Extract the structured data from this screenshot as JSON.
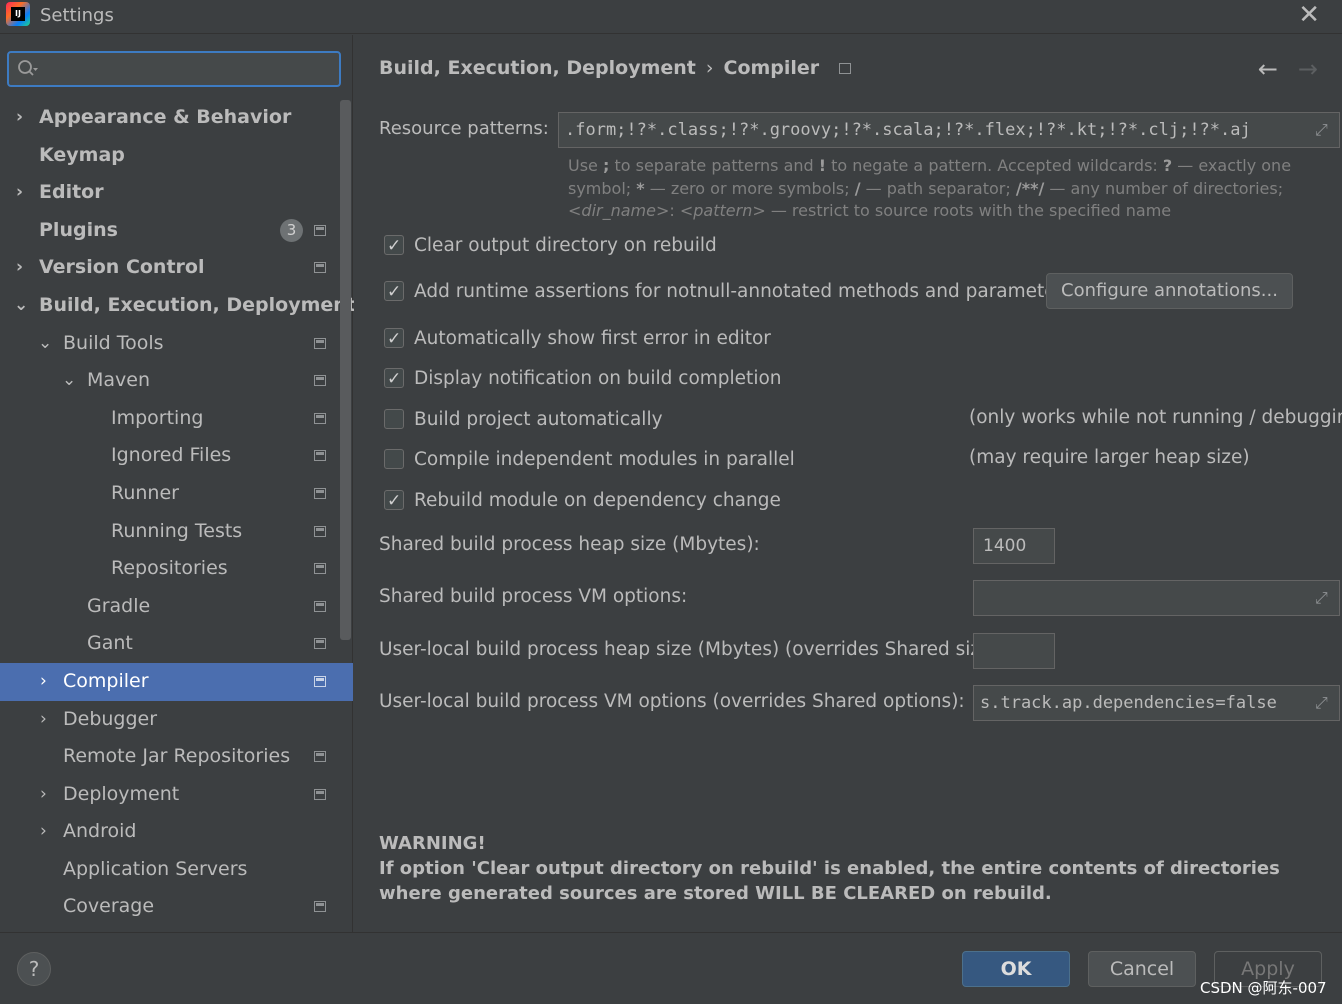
{
  "window": {
    "title": "Settings"
  },
  "search": {
    "placeholder": ""
  },
  "sidebar": {
    "items": [
      {
        "label": "Appearance & Behavior"
      },
      {
        "label": "Keymap"
      },
      {
        "label": "Editor"
      },
      {
        "label": "Plugins",
        "badge": "3"
      },
      {
        "label": "Version Control"
      },
      {
        "label": "Build, Execution, Deployment"
      },
      {
        "label": "Build Tools"
      },
      {
        "label": "Maven"
      },
      {
        "label": "Importing"
      },
      {
        "label": "Ignored Files"
      },
      {
        "label": "Runner"
      },
      {
        "label": "Running Tests"
      },
      {
        "label": "Repositories"
      },
      {
        "label": "Gradle"
      },
      {
        "label": "Gant"
      },
      {
        "label": "Compiler"
      },
      {
        "label": "Debugger"
      },
      {
        "label": "Remote Jar Repositories"
      },
      {
        "label": "Deployment"
      },
      {
        "label": "Android"
      },
      {
        "label": "Application Servers"
      },
      {
        "label": "Coverage"
      }
    ]
  },
  "breadcrumb": {
    "parent": "Build, Execution, Deployment",
    "separator": "›",
    "current": "Compiler"
  },
  "resource_patterns": {
    "label": "Resource patterns:",
    "value": ".form;!?*.class;!?*.groovy;!?*.scala;!?*.flex;!?*.kt;!?*.clj;!?*.aj",
    "hint": {
      "p1": "Use ",
      "b1": ";",
      "p2": " to separate patterns and ",
      "b2": "!",
      "p3": " to negate a pattern. Accepted wildcards: ",
      "b3": "?",
      "p4": " — exactly one symbol; ",
      "b4": "*",
      "p5": " — zero or more symbols; ",
      "b5": "/",
      "p6": " — path separator; ",
      "b6": "/**/",
      "p7": " — any number of directories; ",
      "i1": "<dir_name>",
      "p8": ":",
      "i2": "<pattern>",
      "p9": " — restrict to source roots with the specified name"
    }
  },
  "options": {
    "clear_output": {
      "label": "Clear output directory on rebuild",
      "checked": true
    },
    "runtime_assertions": {
      "label": "Add runtime assertions for notnull-annotated methods and parameters",
      "checked": true
    },
    "configure_button": "Configure annotations...",
    "show_first_error": {
      "label": "Automatically show first error in editor",
      "checked": true
    },
    "display_notification": {
      "label": "Display notification on build completion",
      "checked": true
    },
    "build_auto": {
      "label": "Build project automatically",
      "checked": false,
      "note": "(only works while not running / debugging)"
    },
    "compile_parallel": {
      "label": "Compile independent modules in parallel",
      "checked": false,
      "note": "(may require larger heap size)"
    },
    "rebuild_on_dep": {
      "label": "Rebuild module on dependency change",
      "checked": true
    }
  },
  "fields": {
    "shared_heap": {
      "label": "Shared build process heap size (Mbytes):",
      "value": "1400"
    },
    "shared_vm": {
      "label": "Shared build process VM options:",
      "value": ""
    },
    "user_heap": {
      "label": "User-local build process heap size (Mbytes) (overrides Shared size):",
      "value": ""
    },
    "user_vm": {
      "label": "User-local build process VM options (overrides Shared options):",
      "value": "s.track.ap.dependencies=false"
    }
  },
  "warning": {
    "title": "WARNING!",
    "text": "If option 'Clear output directory on rebuild' is enabled, the entire contents of directories where generated sources are stored WILL BE CLEARED on rebuild."
  },
  "buttons": {
    "help": "?",
    "ok": "OK",
    "cancel": "Cancel",
    "apply": "Apply"
  },
  "watermark": "CSDN @阿东-007"
}
